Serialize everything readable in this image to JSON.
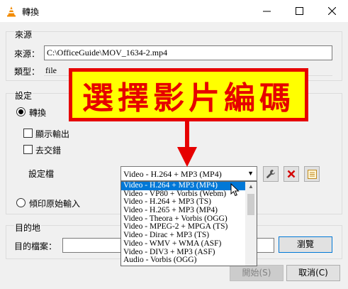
{
  "window": {
    "title": "轉換",
    "icon": "vlc-cone-icon"
  },
  "source": {
    "group_label": "來源",
    "source_label": "來源：",
    "source_value": "C:\\OfficeGuide\\MOV_1634-2.mp4",
    "type_label": "類型：",
    "type_value": "file"
  },
  "settings": {
    "group_label": "設定",
    "convert_label": "轉換",
    "display_output_label": "顯示輸出",
    "deinterlace_label": "去交錯",
    "profile_label": "設定檔",
    "profile_selected": "Video - H.264 + MP3 (MP4)",
    "dump_raw_label": "傾印原始輸入"
  },
  "dropdown": {
    "items": [
      "Video - H.264 + MP3 (MP4)",
      "Video - VP80 + Vorbis (Webm)",
      "Video - H.264 + MP3 (TS)",
      "Video - H.265 + MP3 (MP4)",
      "Video - Theora + Vorbis (OGG)",
      "Video - MPEG-2 + MPGA (TS)",
      "Video - Dirac + MP3 (TS)",
      "Video - WMV + WMA (ASF)",
      "Video - DIV3 + MP3 (ASF)",
      "Audio - Vorbis (OGG)"
    ],
    "selected_index": 0
  },
  "destination": {
    "group_label": "目的地",
    "file_label": "目的檔案：",
    "file_value": "",
    "browse_label": "瀏覽"
  },
  "buttons": {
    "start_label": "開始(S)",
    "cancel_label": "取消(C)"
  },
  "callout": {
    "text": "選擇影片編碼",
    "color": "#e60000",
    "background": "#ffff00"
  }
}
